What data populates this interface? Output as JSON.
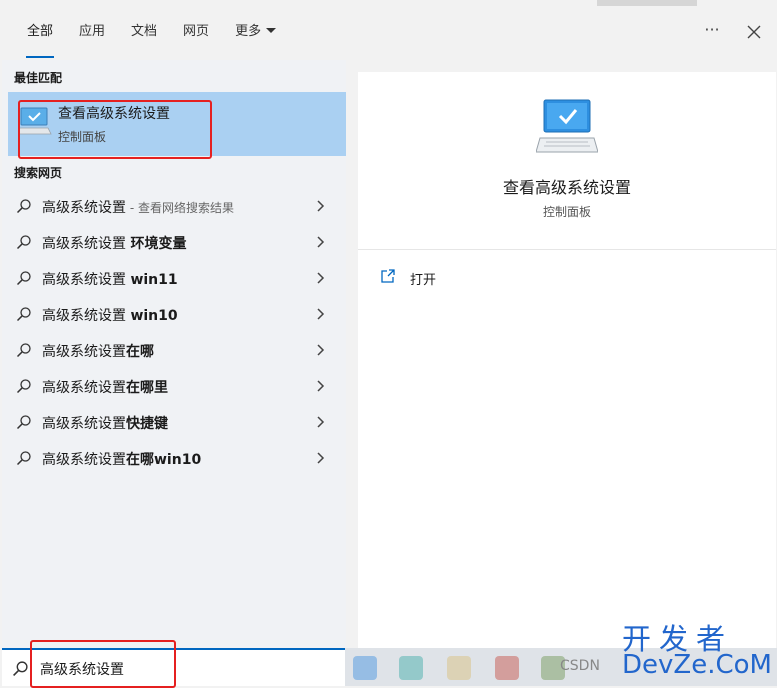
{
  "tabs": [
    {
      "label": "全部"
    },
    {
      "label": "应用"
    },
    {
      "label": "文档"
    },
    {
      "label": "网页"
    },
    {
      "label": "更多"
    }
  ],
  "header": {
    "more_options_icon": "ellipsis-icon",
    "close_icon": "close-icon"
  },
  "best_match": {
    "heading": "最佳匹配",
    "title": "查看高级系统设置",
    "subtitle": "控制面板",
    "icon": "monitor-check-icon"
  },
  "web_search": {
    "heading": "搜索网页",
    "items": [
      {
        "base": "高级系统设置",
        "bold": "",
        "note": " - 查看网络搜索结果"
      },
      {
        "base": "高级系统设置 ",
        "bold": "环境变量",
        "note": ""
      },
      {
        "base": "高级系统设置 ",
        "bold": "win11",
        "note": ""
      },
      {
        "base": "高级系统设置 ",
        "bold": "win10",
        "note": ""
      },
      {
        "base": "高级系统设置",
        "bold": "在哪",
        "note": ""
      },
      {
        "base": "高级系统设置",
        "bold": "在哪里",
        "note": ""
      },
      {
        "base": "高级系统设置",
        "bold": "快捷键",
        "note": ""
      },
      {
        "base": "高级系统设置",
        "bold": "在哪win10",
        "note": ""
      }
    ]
  },
  "detail": {
    "title": "查看高级系统设置",
    "subtitle": "控制面板",
    "actions": [
      {
        "label": "打开",
        "icon": "open-external-icon"
      }
    ]
  },
  "search": {
    "value": "高级系统设置",
    "icon": "search-icon"
  },
  "watermark": {
    "cn": "开发者",
    "en": "DevZe.CoM",
    "csdn": "CSDN"
  },
  "colors": {
    "accent": "#0067c0",
    "selected": "#aad0f2",
    "highlight_box": "#e52020"
  }
}
